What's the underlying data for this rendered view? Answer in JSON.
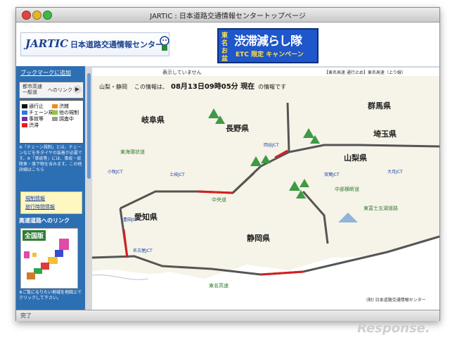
{
  "window": {
    "title": "JARTIC : 日本道路交通情報センタートップページ",
    "status": "完了"
  },
  "header": {
    "logo_text": "JARTIC",
    "logo_org": "日本道路交通情報センター",
    "banner_small": "東名お盆",
    "banner_main": "渋滞減らし隊",
    "banner_sub": "ETC 限定 キャンペーン"
  },
  "sidebar": {
    "bookmark_link": "ブックマークに追加",
    "select_line1": "都市高速",
    "select_line2": "一般道",
    "select_link": "へのリンク",
    "legend": [
      {
        "label": "通行止",
        "color": "#111111"
      },
      {
        "label": "渋雑",
        "color": "#f08a2a"
      },
      {
        "label": "チェーン規制",
        "color": "#2a7ae0"
      },
      {
        "label": "他の規制",
        "color": "#8acb3a"
      },
      {
        "label": "事故等",
        "color": "#7a2a9a"
      },
      {
        "label": "調査中",
        "color": "#9a9a9a"
      },
      {
        "label": "渋滞",
        "color": "#e02020"
      }
    ],
    "notes": "※「チェーン規制」とは、チェーンなどを冬タイヤの装着が必要です。※「事故等」には、事故・故障車・落下物を含みます。この他詳細はこちら",
    "link_kisei": "規制情報",
    "link_ryoko": "旅行時間情報",
    "highway_title": "高速道路へのリンク",
    "zenkoku": "全国版",
    "footer": "※ご覧になりたい地域を地図上でクリックして下さい。"
  },
  "map": {
    "notice": "表示していません",
    "legend_right": "【東名高速 通行止め】東名高速（上り線）",
    "region": "山梨・静岡",
    "time_prefix": "この情報は、",
    "time_value": "08月13日09時05分 現在",
    "time_suffix": "の情報です",
    "prefs": [
      "岐阜県",
      "長野県",
      "群馬県",
      "埼玉県",
      "山梨県",
      "愛知県",
      "静岡県"
    ],
    "roads": [
      "中央道",
      "東海環状道",
      "東名高速",
      "中部横断道",
      "東富士五湖道路"
    ],
    "jcts": [
      "土岐JCT",
      "岡谷JCT",
      "小牧JCT",
      "豊田JCT",
      "名古屋JCT",
      "大月JCT",
      "双葉JCT"
    ],
    "copyright": "(財) 日本道路交通情報センター"
  },
  "watermark": "Response."
}
